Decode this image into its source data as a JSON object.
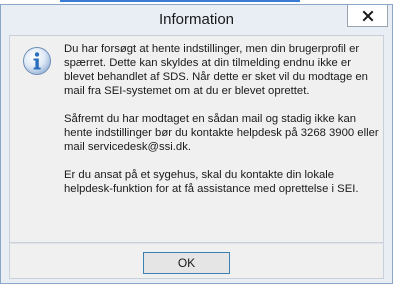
{
  "dialog": {
    "title": "Information",
    "close_icon": "close-icon",
    "info_icon": "info-icon",
    "message": {
      "paragraph1": "Du har forsøgt at hente indstillinger, men din brugerprofil er spærret. Dette kan skyldes at din tilmelding endnu ikke er blevet behandlet af SDS. Når dette er sket vil du modtage en mail fra SEI-systemet om at du er blevet oprettet.",
      "paragraph2": "Såfremt du har modtaget en sådan mail og stadig ikke kan hente indstillinger bør du kontakte helpdesk på 3268 3900 eller mail servicedesk@ssi.dk.",
      "paragraph3": "Er du ansat på et sygehus, skal du kontakte din lokale helpdesk-funktion for at få assistance med oprettelse i SEI."
    },
    "ok_label": "OK"
  },
  "colors": {
    "dialog_frame": "#e9eef5",
    "client_bg": "#f0f0f0",
    "ok_border": "#3c7fb1",
    "info_icon_blue": "#2a6fbf"
  }
}
